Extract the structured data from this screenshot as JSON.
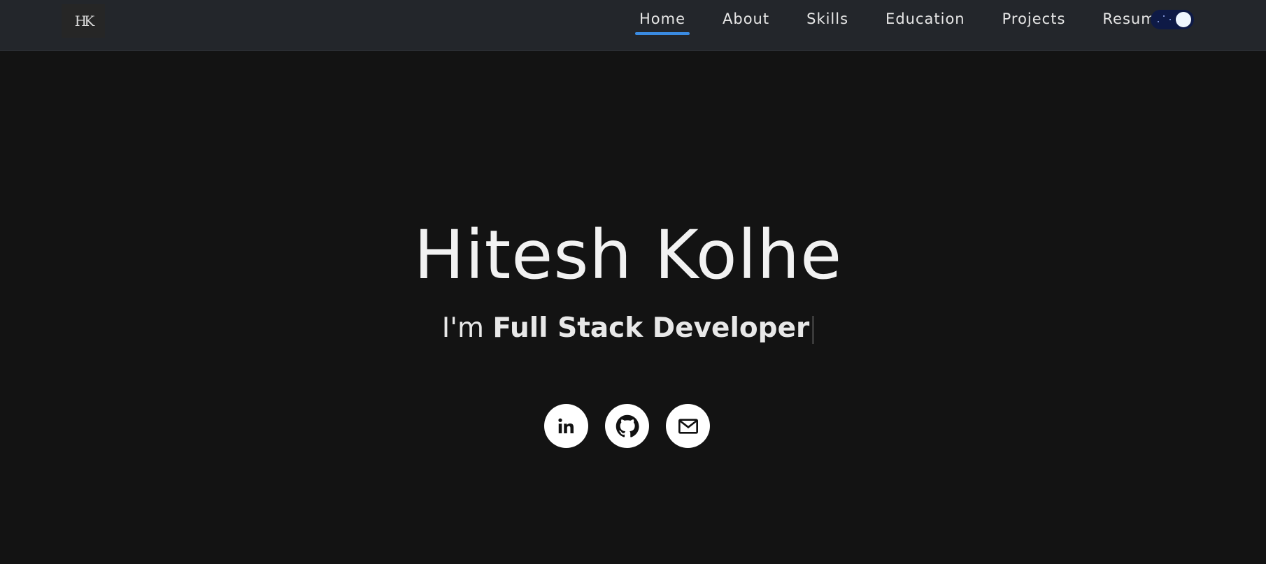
{
  "header": {
    "logo_text": "HK",
    "nav": [
      {
        "label": "Home",
        "active": true
      },
      {
        "label": "About",
        "active": false
      },
      {
        "label": "Skills",
        "active": false
      },
      {
        "label": "Education",
        "active": false
      },
      {
        "label": "Projects",
        "active": false
      },
      {
        "label": "Resume",
        "active": false
      }
    ],
    "theme_toggle": {
      "mode": "dark",
      "icon": "moon-stars-icon"
    }
  },
  "hero": {
    "name": "Hitesh Kolhe",
    "role_prefix": "I'm",
    "role_title": "Full Stack Developer"
  },
  "socials": [
    {
      "icon": "linkedin-icon"
    },
    {
      "icon": "github-icon"
    },
    {
      "icon": "mail-icon"
    }
  ],
  "colors": {
    "background": "#131313",
    "navbar": "#23262b",
    "accent": "#3a8be2",
    "toggle": "#0e1a46"
  }
}
